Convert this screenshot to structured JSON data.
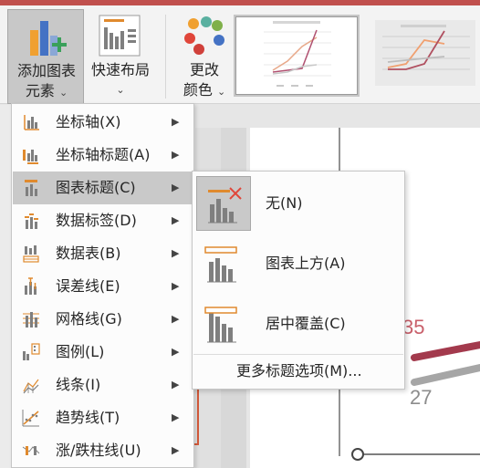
{
  "ribbon": {
    "add_element": {
      "line1": "添加图表",
      "line2": "元素"
    },
    "quick_layout": {
      "label": "快速布局"
    },
    "change_colors": {
      "line1": "更改",
      "line2": "颜色"
    }
  },
  "dropdown": {
    "items": [
      {
        "label": "坐标轴(X)",
        "icon": "axes-icon"
      },
      {
        "label": "坐标轴标题(A)",
        "icon": "axis-titles-icon"
      },
      {
        "label": "图表标题(C)",
        "icon": "chart-title-icon",
        "active": true
      },
      {
        "label": "数据标签(D)",
        "icon": "data-labels-icon"
      },
      {
        "label": "数据表(B)",
        "icon": "data-table-icon"
      },
      {
        "label": "误差线(E)",
        "icon": "error-bars-icon"
      },
      {
        "label": "网格线(G)",
        "icon": "gridlines-icon"
      },
      {
        "label": "图例(L)",
        "icon": "legend-icon"
      },
      {
        "label": "线条(I)",
        "icon": "lines-icon"
      },
      {
        "label": "趋势线(T)",
        "icon": "trendline-icon"
      },
      {
        "label": "涨/跌柱线(U)",
        "icon": "up-down-bars-icon"
      }
    ]
  },
  "submenu": {
    "items": [
      {
        "label": "无(N)",
        "icon": "no-title-icon",
        "active": true
      },
      {
        "label": "图表上方(A)",
        "icon": "title-above-icon"
      },
      {
        "label": "居中覆盖(C)",
        "icon": "title-centered-overlay-icon"
      }
    ],
    "more": "更多标题选项(M)..."
  },
  "chart_fragment": {
    "labels": [
      "35",
      "27"
    ]
  },
  "colors": {
    "accent_red": "#c0504d",
    "series_line": "#a33a4d",
    "series_gray": "#a6a6a6",
    "icon_orange": "#e08a2e"
  }
}
